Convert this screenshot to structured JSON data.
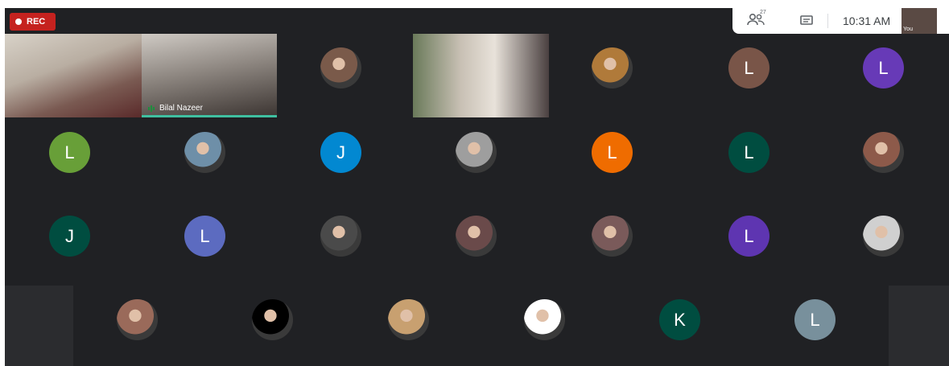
{
  "recording": {
    "label": "REC"
  },
  "topbar": {
    "participants_count": "27",
    "time": "10:31 AM",
    "self_label": "You"
  },
  "video_tiles": [
    {
      "name": ""
    },
    {
      "name": "Bilal Nazeer"
    },
    {
      "name": ""
    }
  ],
  "avatars": [
    {
      "initial": "",
      "color": "#7a5a4a",
      "kind": "photo"
    },
    {
      "initial": "",
      "color": "#b07a3a",
      "kind": "photo"
    },
    {
      "initial": "L",
      "color": "#795548",
      "kind": "letter"
    },
    {
      "initial": "L",
      "color": "#673ab7",
      "kind": "letter"
    },
    {
      "initial": "L",
      "color": "#689f38",
      "kind": "letter"
    },
    {
      "initial": "",
      "color": "#6e8fa8",
      "kind": "photo"
    },
    {
      "initial": "J",
      "color": "#0288d1",
      "kind": "letter"
    },
    {
      "initial": "",
      "color": "#9e9e9e",
      "kind": "photo"
    },
    {
      "initial": "L",
      "color": "#ef6c00",
      "kind": "letter"
    },
    {
      "initial": "L",
      "color": "#004d40",
      "kind": "letter"
    },
    {
      "initial": "",
      "color": "#8d5a4a",
      "kind": "photo"
    },
    {
      "initial": "J",
      "color": "#004d40",
      "kind": "letter"
    },
    {
      "initial": "L",
      "color": "#5c6bc0",
      "kind": "letter"
    },
    {
      "initial": "",
      "color": "#4a4a4a",
      "kind": "photo"
    },
    {
      "initial": "",
      "color": "#6a4a4a",
      "kind": "photo"
    },
    {
      "initial": "",
      "color": "#7a5a5a",
      "kind": "photo"
    },
    {
      "initial": "L",
      "color": "#5e35b1",
      "kind": "letter"
    },
    {
      "initial": "",
      "color": "#d0d0d0",
      "kind": "photo"
    },
    {
      "initial": "",
      "color": "#9a6a5a",
      "kind": "photo"
    },
    {
      "initial": "",
      "color": "#000000",
      "kind": "photo"
    },
    {
      "initial": "",
      "color": "#c8a070",
      "kind": "photo"
    },
    {
      "initial": "",
      "color": "#ffffff",
      "kind": "photo"
    },
    {
      "initial": "K",
      "color": "#004d40",
      "kind": "letter"
    },
    {
      "initial": "L",
      "color": "#78909c",
      "kind": "letter"
    }
  ]
}
